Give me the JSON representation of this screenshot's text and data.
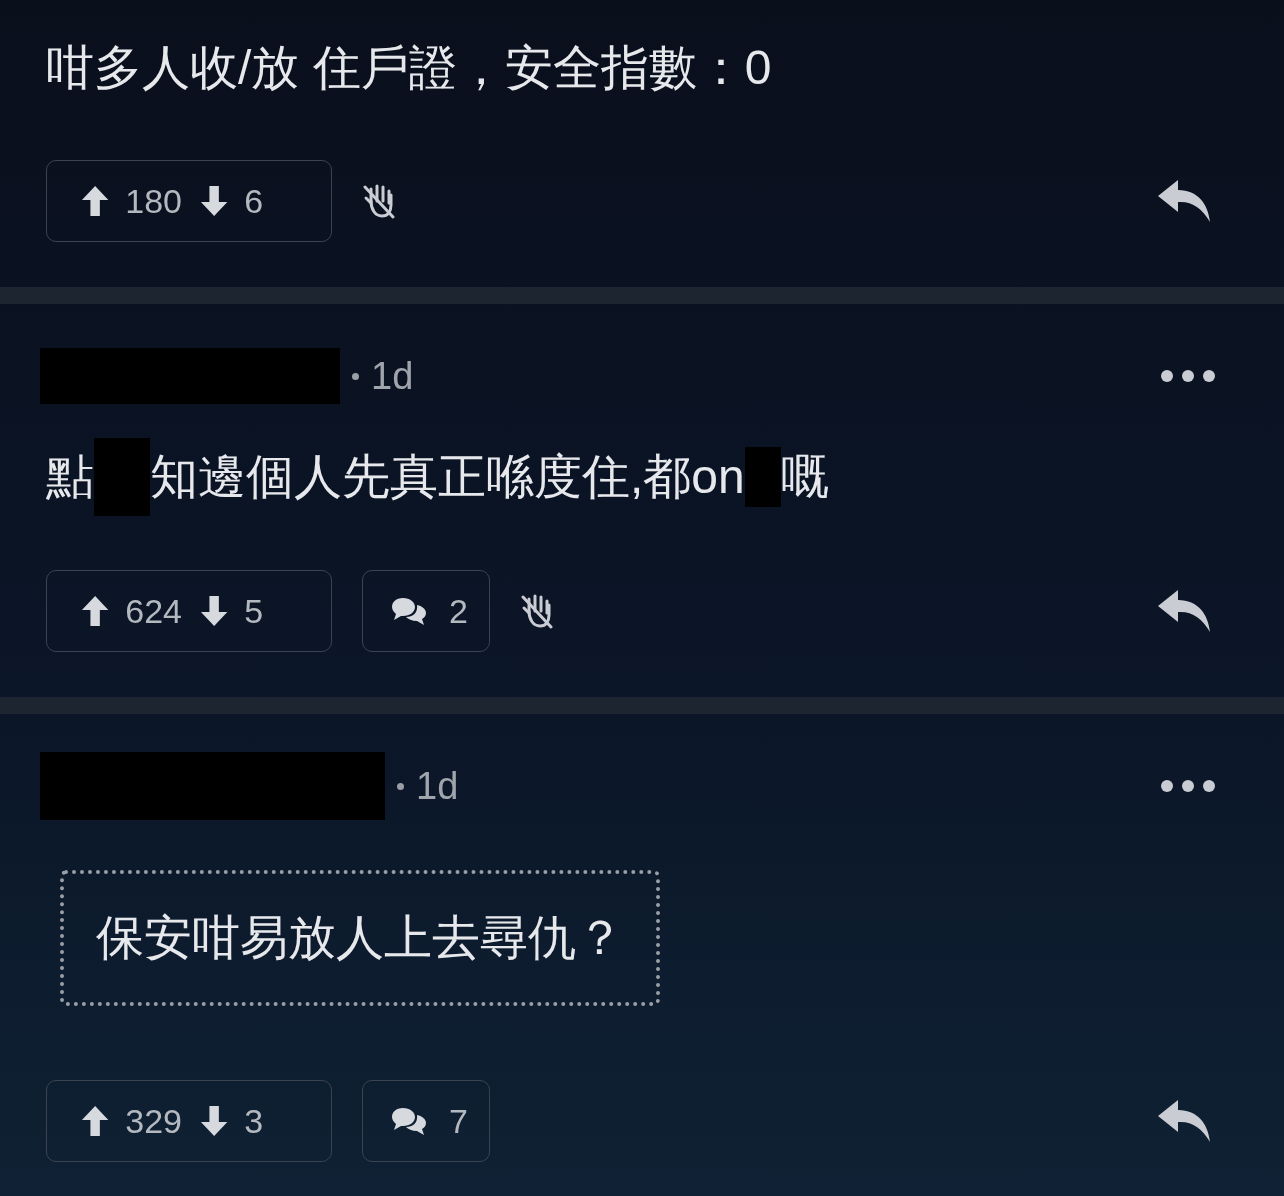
{
  "posts": [
    {
      "body": [
        {
          "kind": "text",
          "text": "咁多人收/放 住戶證，安全指數：0"
        }
      ],
      "kind": "plain",
      "upvotes": "180",
      "downvotes": "6",
      "hand_button": true
    },
    {
      "author": {
        "kind": "redacted"
      },
      "time": "1d",
      "body": [
        {
          "kind": "text",
          "text": "點"
        },
        {
          "kind": "redacted"
        },
        {
          "kind": "text",
          "text": "知邊個人先真正喺度住,都on"
        },
        {
          "kind": "redacted"
        },
        {
          "kind": "text",
          "text": "嘅"
        }
      ],
      "kind": "plain",
      "upvotes": "624",
      "downvotes": "5",
      "replies": "2",
      "hand_button": true
    },
    {
      "author": {
        "kind": "redacted"
      },
      "time": "1d",
      "body": [
        {
          "kind": "text",
          "text": "保安咁易放人上去尋仇？"
        }
      ],
      "kind": "quote",
      "upvotes": "329",
      "downvotes": "3",
      "replies": "7",
      "hand_button": false
    }
  ]
}
